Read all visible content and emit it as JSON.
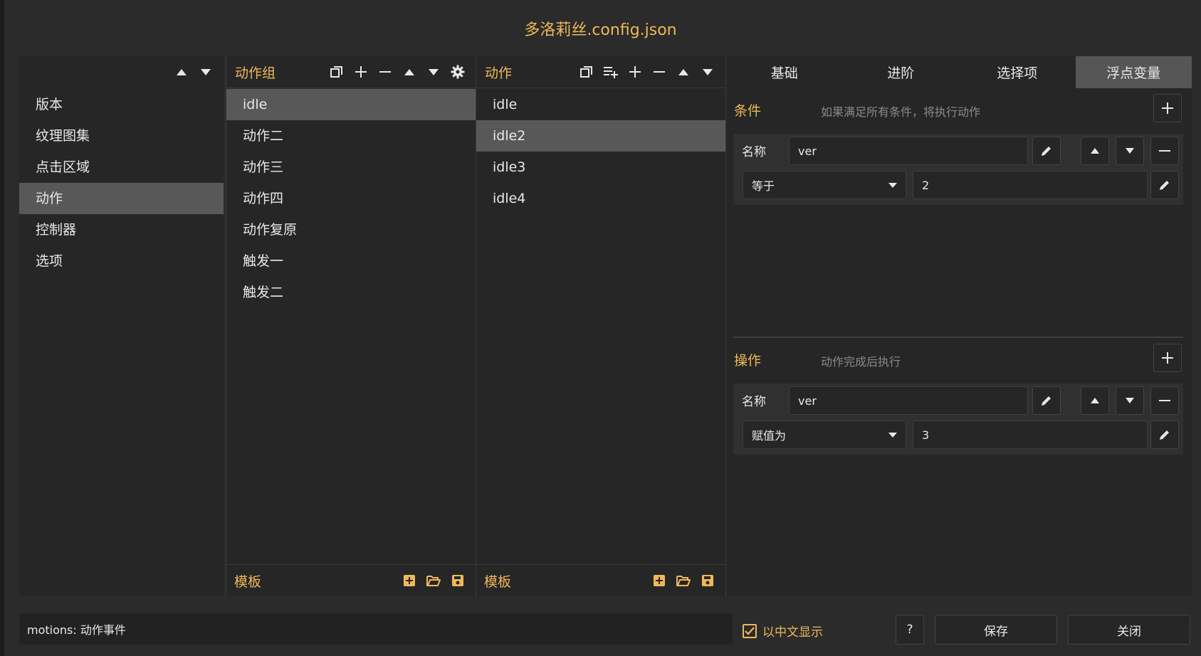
{
  "window": {
    "title": "多洛莉丝.config.json"
  },
  "categories": {
    "items": [
      {
        "label": "版本"
      },
      {
        "label": "纹理图集"
      },
      {
        "label": "点击区域"
      },
      {
        "label": "动作",
        "selected": true
      },
      {
        "label": "控制器"
      },
      {
        "label": "选项"
      }
    ]
  },
  "motion_groups": {
    "header": "动作组",
    "items": [
      {
        "label": "idle",
        "selected": true
      },
      {
        "label": "动作二"
      },
      {
        "label": "动作三"
      },
      {
        "label": "动作四"
      },
      {
        "label": "动作复原"
      },
      {
        "label": "触发一"
      },
      {
        "label": "触发二"
      }
    ],
    "footer": "模板"
  },
  "motions": {
    "header": "动作",
    "items": [
      {
        "label": "idle"
      },
      {
        "label": "idle2",
        "selected": true
      },
      {
        "label": "idle3"
      },
      {
        "label": "idle4"
      }
    ],
    "footer": "模板"
  },
  "tabs": [
    {
      "label": "基础"
    },
    {
      "label": "进阶"
    },
    {
      "label": "选择项"
    },
    {
      "label": "浮点变量",
      "active": true
    }
  ],
  "conditions": {
    "title": "条件",
    "hint": "如果满足所有条件，将执行动作",
    "name_label": "名称",
    "name_value": "ver",
    "operator": "等于",
    "value": "2"
  },
  "operations": {
    "title": "操作",
    "hint": "动作完成后执行",
    "name_label": "名称",
    "name_value": "ver",
    "operator": "赋值为",
    "value": "3"
  },
  "status": {
    "text": "motions: 动作事件"
  },
  "chinese_display": {
    "label": "以中文显示",
    "checked": true
  },
  "buttons": {
    "help": "?",
    "save": "保存",
    "close": "关闭"
  },
  "colors": {
    "accent": "#f0b85a",
    "background": "#2b2b2b",
    "panel": "#262626",
    "selected": "#585858"
  }
}
